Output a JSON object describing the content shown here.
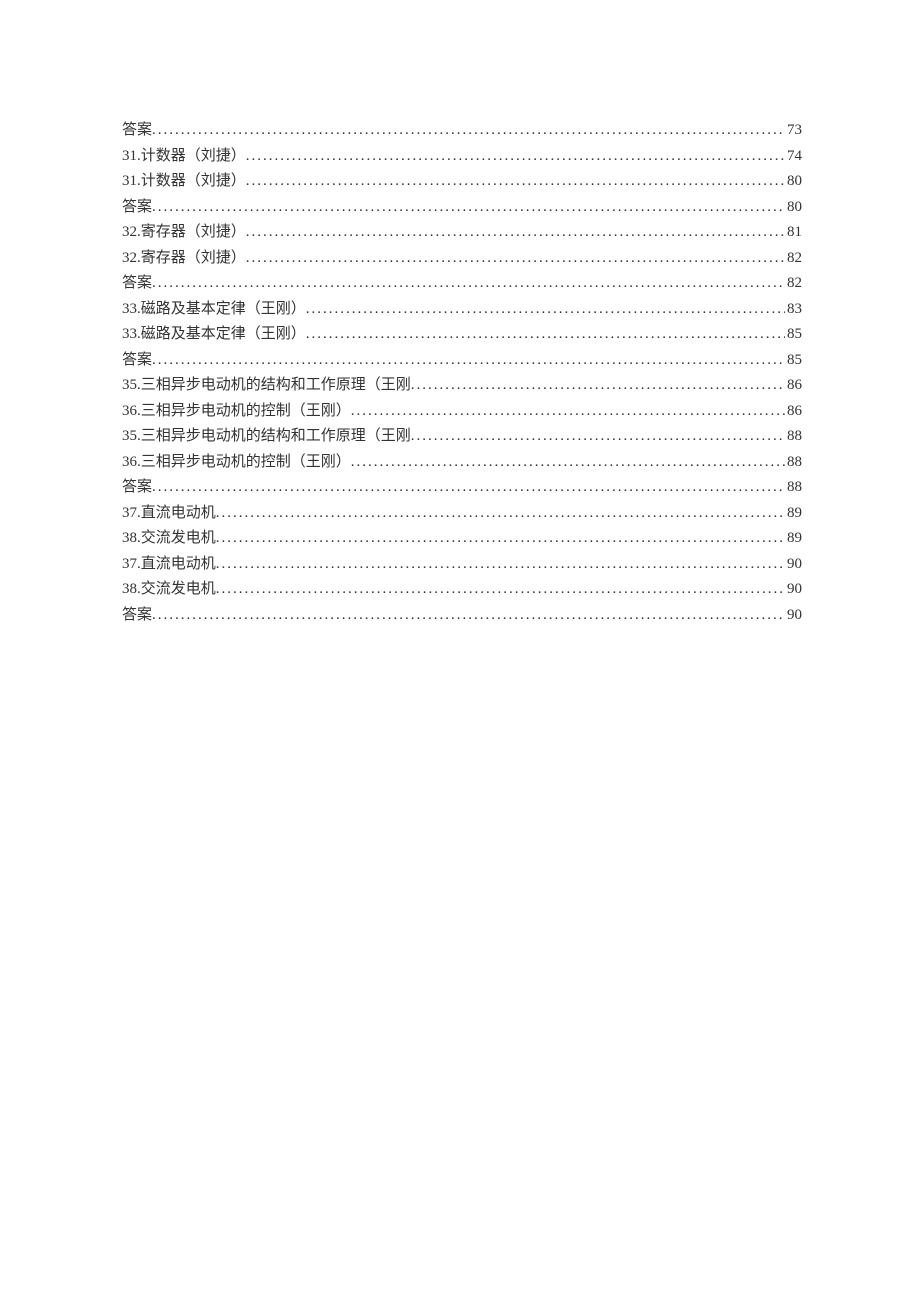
{
  "entries": [
    {
      "title": "答案",
      "page": "73"
    },
    {
      "title": "31.计数器（刘捷）",
      "page": "74"
    },
    {
      "title": "31.计数器（刘捷）",
      "page": "80"
    },
    {
      "title": "答案",
      "page": "80"
    },
    {
      "title": "32.寄存器（刘捷）",
      "page": "81"
    },
    {
      "title": "32.寄存器（刘捷）",
      "page": "82"
    },
    {
      "title": "答案",
      "page": "82"
    },
    {
      "title": "33.磁路及基本定律（王刚）",
      "page": "83"
    },
    {
      "title": "33.磁路及基本定律（王刚）",
      "page": "85"
    },
    {
      "title": "答案",
      "page": "85"
    },
    {
      "title": "35.三相异步电动机的结构和工作原理（王刚",
      "page": "86"
    },
    {
      "title": "36.三相异步电动机的控制（王刚）",
      "page": "86"
    },
    {
      "title": "35.三相异步电动机的结构和工作原理（王刚",
      "page": "88"
    },
    {
      "title": "36.三相异步电动机的控制（王刚）",
      "page": "88"
    },
    {
      "title": "答案",
      "page": "88"
    },
    {
      "title": "37.直流电动机",
      "page": "89"
    },
    {
      "title": "38.交流发电机",
      "page": "89"
    },
    {
      "title": "37.直流电动机",
      "page": "90"
    },
    {
      "title": "38.交流发电机",
      "page": "90"
    },
    {
      "title": "答案",
      "page": "90"
    }
  ]
}
